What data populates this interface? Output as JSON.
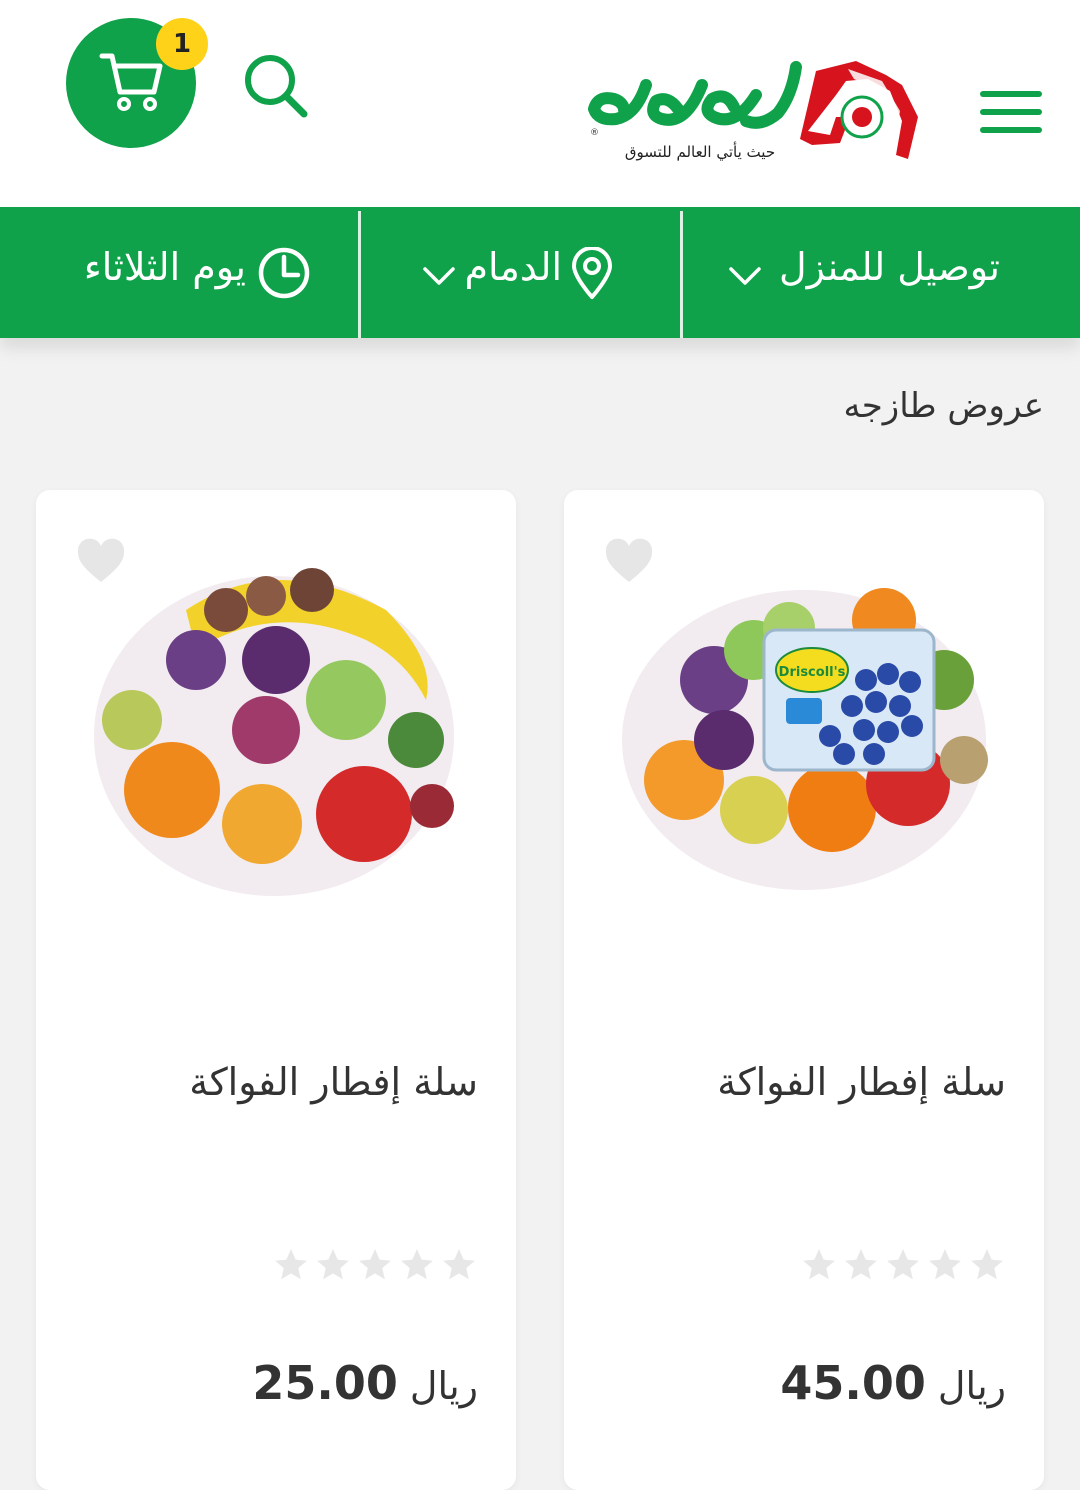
{
  "header": {
    "logo_text": "لولو",
    "logo_tagline": "حيث يأتي العالم للتسوق",
    "cart_count": "1",
    "brand_color": "#0fa24a",
    "badge_color": "#ffd21a"
  },
  "icons": {
    "menu": "hamburger-menu-icon",
    "search": "search-icon",
    "cart": "shopping-cart-icon",
    "clock": "clock-icon",
    "location": "location-pin-icon",
    "chevron": "chevron-down-icon",
    "heart": "heart-icon",
    "star": "star-icon"
  },
  "navbar": {
    "delivery_label": "توصيل للمنزل",
    "city_label": "الدمام",
    "day_label": "يوم الثلاثاء"
  },
  "section": {
    "title": "عروض طازجه"
  },
  "products": [
    {
      "name": "سلة إفطار الفواكة",
      "currency": "ريال",
      "price": "45.00",
      "rating": 0,
      "image_badge": "Driscoll's"
    },
    {
      "name": "سلة إفطار الفواكة",
      "currency": "ريال",
      "price": "25.00",
      "rating": 0
    }
  ]
}
